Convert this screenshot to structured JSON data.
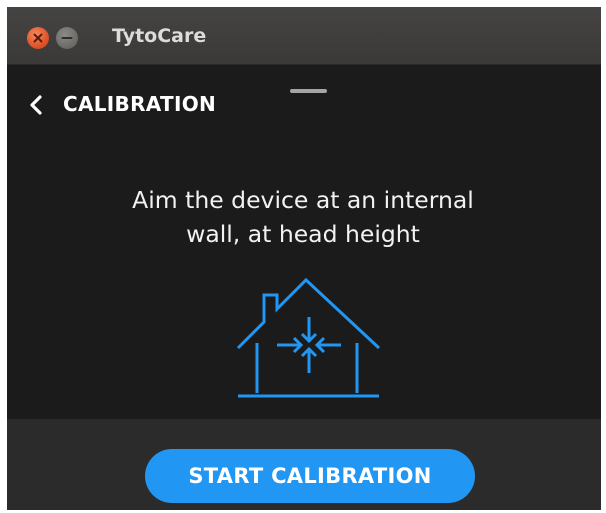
{
  "window": {
    "app_title": "TytoCare",
    "close_icon": "close-icon",
    "minimize_icon": "minimize-icon"
  },
  "header": {
    "back_icon": "chevron-left-icon",
    "title": "CALIBRATION"
  },
  "main": {
    "instruction_line1": "Aim the device at an internal",
    "instruction_line2": "wall, at head height",
    "illustration_icon": "house-arrows-icon",
    "accent_color": "#2196f3"
  },
  "footer": {
    "start_button_label": "START CALIBRATION"
  }
}
